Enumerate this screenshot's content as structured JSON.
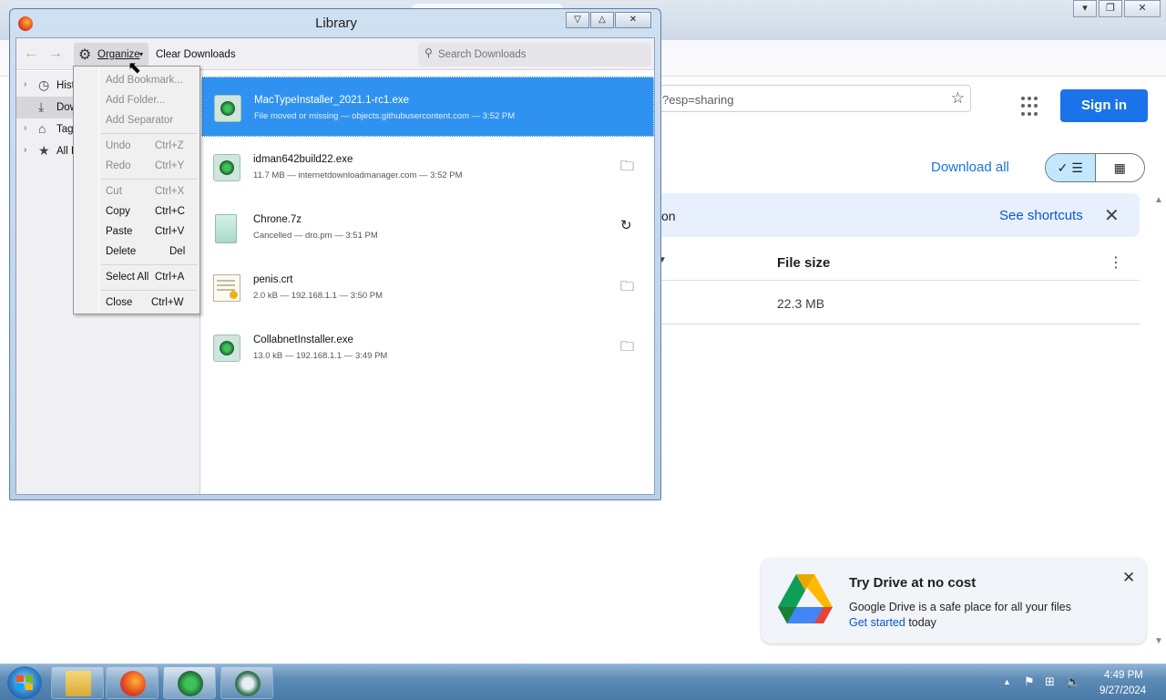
{
  "background_browser": {
    "url_partial": "?esp=sharing",
    "sign_in_label": "Sign in",
    "download_all_label": "Download all",
    "banner_text": "on",
    "see_shortcuts_label": "See shortcuts",
    "column_file_size": "File size",
    "row_file_size": "22.3 MB",
    "promo": {
      "title": "Try Drive at no cost",
      "description": "Google Drive is a safe place for all your files",
      "link_label": "Get started",
      "after_link": " today"
    }
  },
  "library": {
    "title": "Library",
    "toolbar": {
      "organize_label": "Organize",
      "clear_downloads_label": "Clear Downloads",
      "search_placeholder": "Search Downloads"
    },
    "sidebar": [
      {
        "label": "Hist",
        "icon": "clock-icon"
      },
      {
        "label": "Dow",
        "icon": "download-icon",
        "selected": true
      },
      {
        "label": "Tag",
        "icon": "tag-icon"
      },
      {
        "label": "All B",
        "icon": "star-icon"
      }
    ],
    "downloads": [
      {
        "name": "MacTypeInstaller_2021.1-rc1.exe",
        "meta": "File moved or missing — objects.githubusercontent.com — 3:52 PM",
        "selected": true,
        "action": "none",
        "icon": "exe"
      },
      {
        "name": "idman642build22.exe",
        "meta": "11.7 MB — internetdownloadmanager.com — 3:52 PM",
        "action": "folder",
        "icon": "exe"
      },
      {
        "name": "Chrone.7z",
        "meta": "Cancelled — dro.pm — 3:51 PM",
        "action": "retry",
        "icon": "zip"
      },
      {
        "name": "penis.crt",
        "meta": "2.0 kB — 192.168.1.1 — 3:50 PM",
        "action": "folder",
        "icon": "crt"
      },
      {
        "name": "CollabnetInstaller.exe",
        "meta": "13.0 kB — 192.168.1.1 — 3:49 PM",
        "action": "folder",
        "icon": "exe"
      }
    ]
  },
  "organize_menu": {
    "items": [
      {
        "label": "Add Bookmark...",
        "shortcut": "",
        "disabled": true
      },
      {
        "label": "Add Folder...",
        "shortcut": "",
        "disabled": true
      },
      {
        "label": "Add Separator",
        "shortcut": "",
        "disabled": true
      },
      {
        "label": "Undo",
        "shortcut": "Ctrl+Z",
        "disabled": true
      },
      {
        "label": "Redo",
        "shortcut": "Ctrl+Y",
        "disabled": true
      },
      {
        "label": "Cut",
        "shortcut": "Ctrl+X",
        "disabled": true
      },
      {
        "label": "Copy",
        "shortcut": "Ctrl+C",
        "disabled": false
      },
      {
        "label": "Paste",
        "shortcut": "Ctrl+V",
        "disabled": false
      },
      {
        "label": "Delete",
        "shortcut": "Del",
        "disabled": false
      },
      {
        "label": "Select All",
        "shortcut": "Ctrl+A",
        "disabled": false
      },
      {
        "label": "Close",
        "shortcut": "Ctrl+W",
        "disabled": false
      }
    ]
  },
  "taskbar": {
    "clock_time": "4:49 PM",
    "clock_date": "9/27/2024"
  },
  "colors": {
    "accent": "#1a73e8",
    "selection": "#3092f0"
  }
}
